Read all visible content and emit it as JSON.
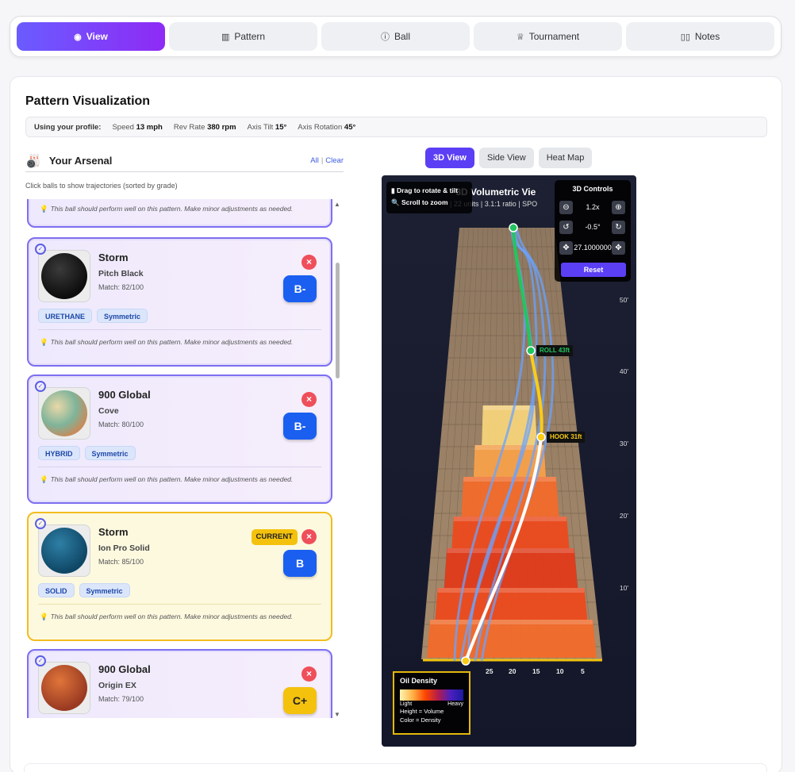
{
  "nav": {
    "tabs": [
      {
        "label": "View",
        "icon": "eye-icon"
      },
      {
        "label": "Pattern",
        "icon": "bar-chart-icon"
      },
      {
        "label": "Ball",
        "icon": "info-icon"
      },
      {
        "label": "Tournament",
        "icon": "trophy-icon"
      },
      {
        "label": "Notes",
        "icon": "book-icon"
      }
    ],
    "active": "View"
  },
  "page": {
    "title": "Pattern Visualization"
  },
  "profile": {
    "label": "Using your profile:",
    "speed_label": "Speed",
    "speed_value": "13 mph",
    "rev_label": "Rev Rate",
    "rev_value": "380 rpm",
    "tilt_label": "Axis Tilt",
    "tilt_value": "15°",
    "rotation_label": "Axis Rotation",
    "rotation_value": "45°"
  },
  "arsenal": {
    "title": "Your Arsenal",
    "all_label": "All",
    "clear_label": "Clear",
    "hint": "Click balls to show trajectories (sorted by grade)",
    "note_text": "This ball should perform well on this pattern. Make minor adjustments as needed.",
    "balls": [
      {
        "brand": "Storm",
        "model": "Pitch Black",
        "match": "Match: 82/100",
        "grade": "B-",
        "tags": [
          "URETHANE",
          "Symmetric"
        ],
        "note": "This ball should perform well on this pattern. Make minor adjustments as needed.",
        "current": false
      },
      {
        "brand": "900 Global",
        "model": "Cove",
        "match": "Match: 80/100",
        "grade": "B-",
        "tags": [
          "HYBRID",
          "Symmetric"
        ],
        "note": "This ball should perform well on this pattern. Make minor adjustments as needed.",
        "current": false
      },
      {
        "brand": "Storm",
        "model": "Ion Pro Solid",
        "match": "Match: 85/100",
        "grade": "B",
        "tags": [
          "SOLID",
          "Symmetric"
        ],
        "note": "This ball should perform well on this pattern. Make minor adjustments as needed.",
        "current": true,
        "current_label": "CURRENT"
      },
      {
        "brand": "900 Global",
        "model": "Origin EX",
        "match": "Match: 79/100",
        "grade": "C+",
        "tags": [],
        "note": "",
        "current": false
      }
    ]
  },
  "views": {
    "tabs": [
      "3D View",
      "Side View",
      "Heat Map"
    ],
    "active": "3D View"
  },
  "viewer": {
    "title": "- 3D Volumetric Vie",
    "subtitle": "| 22 units | 3.1:1 ratio | SPO",
    "instructions": [
      "Drag to rotate & tilt",
      "Scroll to zoom"
    ],
    "controls": {
      "title": "3D Controls",
      "zoom": "1.2x",
      "rotation": "-0.5°",
      "pan": "27.1000000",
      "reset_label": "Reset"
    },
    "feet_labels": [
      "50'",
      "40'",
      "30'",
      "20'",
      "10'"
    ],
    "board_labels": [
      "25",
      "20",
      "15",
      "10",
      "5"
    ],
    "roll_label": "ROLL 43ft",
    "hook_label": "HOOK 31ft",
    "legend": {
      "title": "Oil Density",
      "light": "Light",
      "heavy": "Heavy",
      "line1": "Height = Volume",
      "line2": "Color = Density"
    },
    "colors": {
      "roll": "#22c55e",
      "hook": "#facc15",
      "path": "#ffffff",
      "alt_path": "#6aa3ff"
    }
  }
}
